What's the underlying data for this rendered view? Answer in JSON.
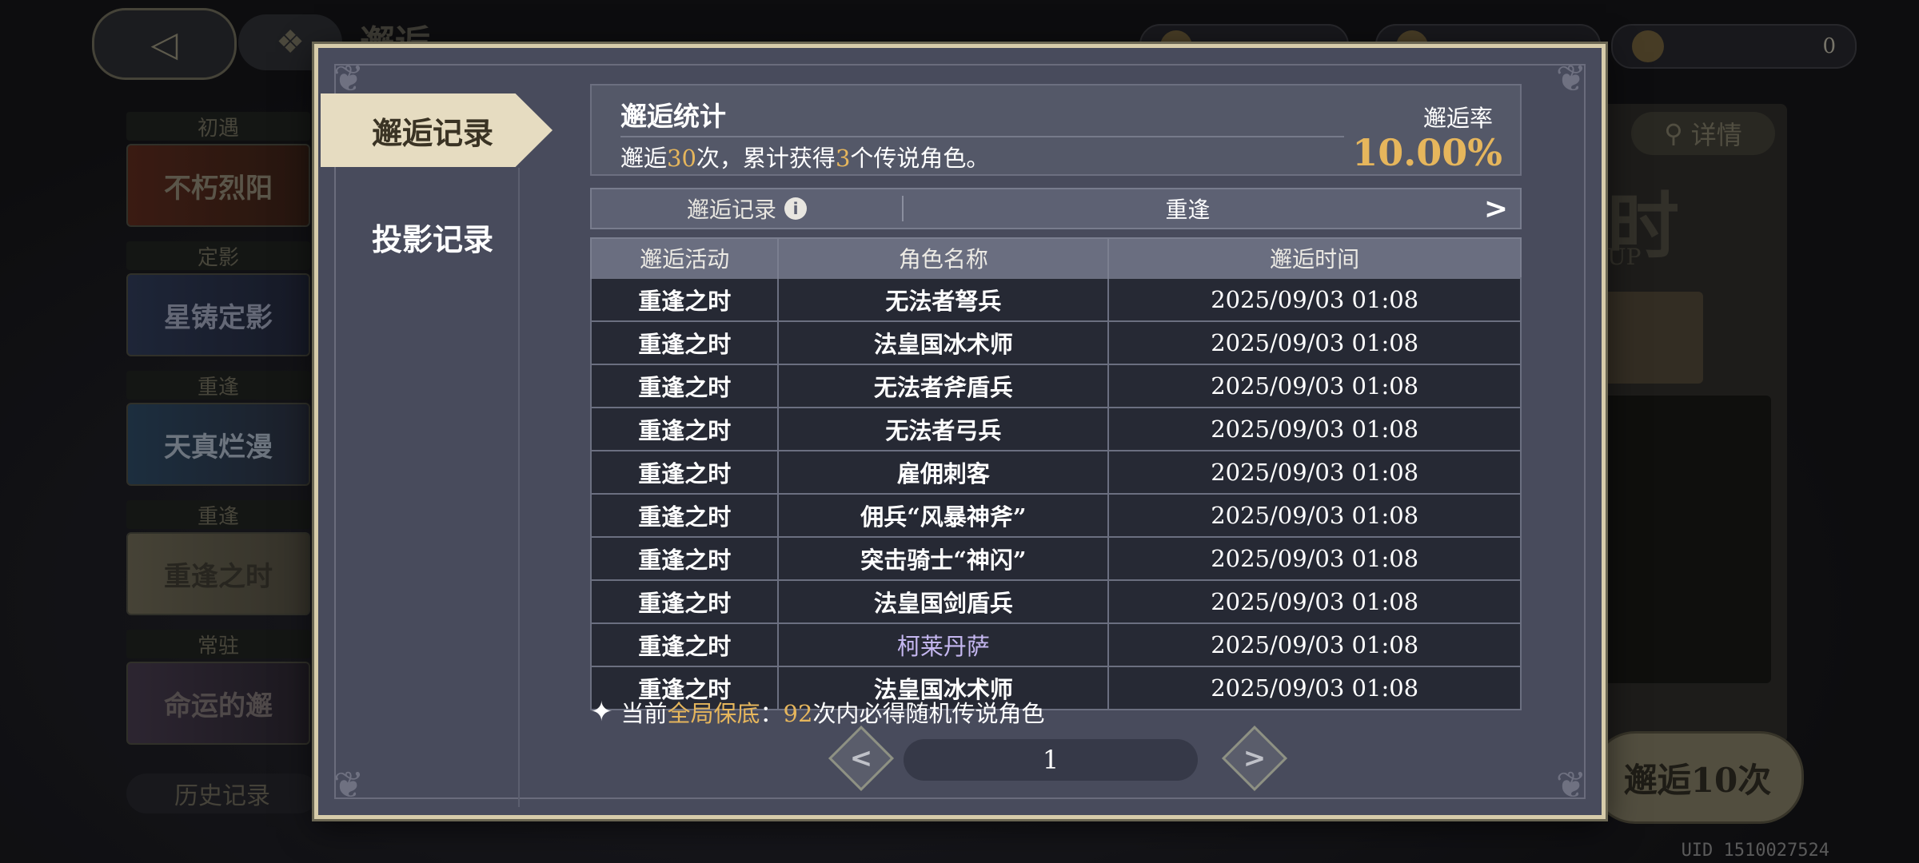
{
  "background": {
    "page_title": "邂逅",
    "currency_3_value": "0",
    "banners": [
      {
        "tag": "初遇",
        "art_text": "不朽烈阳"
      },
      {
        "tag": "定影",
        "art_text": "星铸定影"
      },
      {
        "tag": "重逢",
        "art_text": "天真烂漫"
      },
      {
        "tag": "重逢",
        "art_text": "重逢之时"
      },
      {
        "tag": "常驻",
        "art_text": "命运的邂"
      }
    ],
    "history_label": "历史记录",
    "detail_label": "详情",
    "big_char": "时",
    "up_text": "UP",
    "pull10_label": "邂逅10次",
    "uid": "UID 1510027524"
  },
  "modal": {
    "tabs": [
      {
        "label": "邂逅记录",
        "active": true
      },
      {
        "label": "投影记录",
        "active": false
      }
    ],
    "stats": {
      "title": "邂逅统计",
      "desc_prefix": "邂逅",
      "pull_count": "30",
      "desc_middle": "次，累计获得",
      "legend_count": "3",
      "desc_suffix": "个传说角色。",
      "rate_label": "邂逅率",
      "rate_value": "10.00%"
    },
    "filter": {
      "left_label": "邂逅记录",
      "info_icon": "i",
      "selected": "重逢",
      "arrow": ">"
    },
    "table": {
      "headers": [
        "邂逅活动",
        "角色名称",
        "邂逅时间"
      ],
      "rows": [
        {
          "activity": "重逢之时",
          "name": "无法者弩兵",
          "time": "2025/09/03 01:08"
        },
        {
          "activity": "重逢之时",
          "name": "法皇国冰术师",
          "time": "2025/09/03 01:08"
        },
        {
          "activity": "重逢之时",
          "name": "无法者斧盾兵",
          "time": "2025/09/03 01:08"
        },
        {
          "activity": "重逢之时",
          "name": "无法者弓兵",
          "time": "2025/09/03 01:08"
        },
        {
          "activity": "重逢之时",
          "name": "雇佣刺客",
          "time": "2025/09/03 01:08"
        },
        {
          "activity": "重逢之时",
          "name": "佣兵“风暴神斧”",
          "time": "2025/09/03 01:08"
        },
        {
          "activity": "重逢之时",
          "name": "突击骑士“神闪”",
          "time": "2025/09/03 01:08"
        },
        {
          "activity": "重逢之时",
          "name": "法皇国剑盾兵",
          "time": "2025/09/03 01:08"
        },
        {
          "activity": "重逢之时",
          "name": "柯莱丹萨",
          "time": "2025/09/03 01:08",
          "rarity_color": "#c5b7f0"
        },
        {
          "activity": "重逢之时",
          "name": "法皇国冰术师",
          "time": "2025/09/03 01:08"
        }
      ]
    },
    "pity": {
      "prefix": "当前",
      "highlight": "全局保底",
      "colon": "：",
      "count": "92",
      "suffix": "次内必得随机传说角色"
    },
    "pager": {
      "current_page": "1",
      "prev": "<",
      "next": ">"
    }
  },
  "colors": {
    "accent_gold": "#e6b65c",
    "legend_purple": "#c5b7f0",
    "modal_bg": "#484b5c"
  }
}
